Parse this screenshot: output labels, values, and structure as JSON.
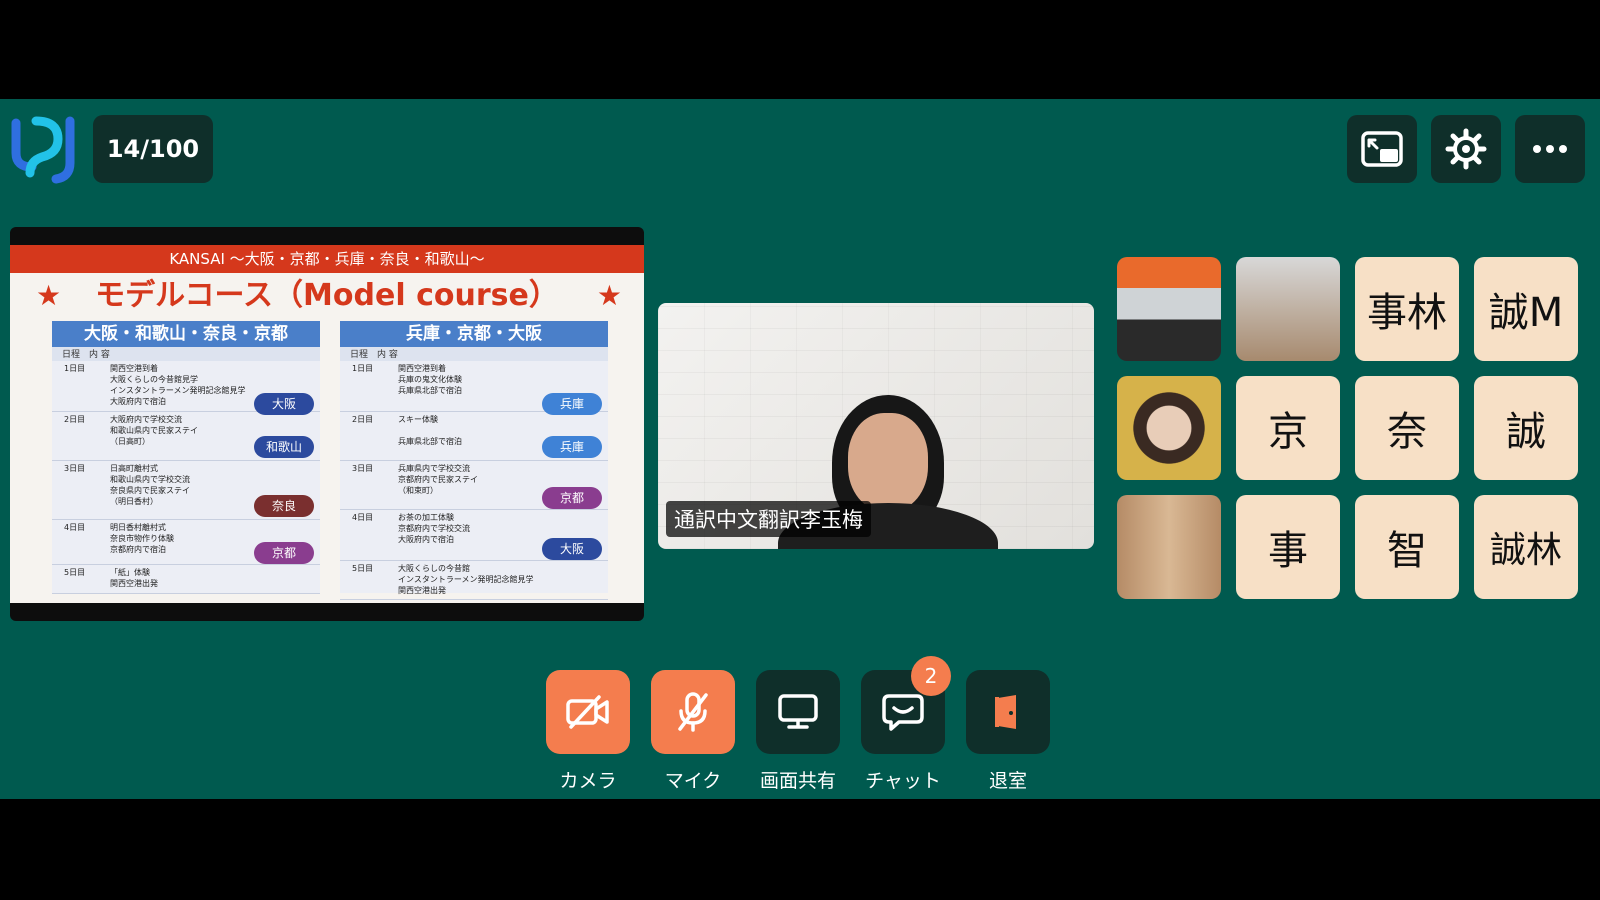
{
  "header": {
    "slide_counter": "14/100"
  },
  "colors": {
    "app_bg": "#005a4f",
    "accent": "#f47d4e",
    "button_dark": "#0f2f2a",
    "name_tile": "#f7e0c6"
  },
  "slide": {
    "banner": "KANSAI 〜大阪・京都・兵庫・奈良・和歌山〜",
    "title": "モデルコース（Model course）",
    "star": "★",
    "left_col": {
      "heading": "大阪・和歌山・奈良・京都",
      "sub": "日程　内 容",
      "rows": [
        {
          "day": "1日目",
          "lines": [
            "関西空港到着",
            "大阪くらしの今昔館見学",
            "インスタントラーメン発明記念館見学",
            "大阪府内で宿泊"
          ]
        },
        {
          "day": "2日目",
          "lines": [
            "大阪府内で学校交流",
            "和歌山県内で民家ステイ",
            "（日高町）"
          ]
        },
        {
          "day": "3日目",
          "lines": [
            "日高町離村式",
            "和歌山県内で学校交流",
            "奈良県内で民家ステイ",
            "（明日香村）"
          ]
        },
        {
          "day": "4日目",
          "lines": [
            "明日香村離村式",
            "奈良市物作り体験",
            "京都府内で宿泊"
          ]
        },
        {
          "day": "5日目",
          "lines": [
            "「紙」体験",
            "関西空港出発"
          ]
        }
      ],
      "pills": [
        "大阪",
        "和歌山",
        "奈良",
        "京都"
      ]
    },
    "right_col": {
      "heading": "兵庫・京都・大阪",
      "sub": "日程　内 容",
      "rows": [
        {
          "day": "1日目",
          "lines": [
            "関西空港到着",
            "兵庫の鬼文化体験",
            "兵庫県北部で宿泊"
          ]
        },
        {
          "day": "2日目",
          "lines": [
            "スキー体験",
            "兵庫県北部で宿泊"
          ]
        },
        {
          "day": "3日目",
          "lines": [
            "兵庫県内で学校交流",
            "京都府内で民家ステイ",
            "（和束町）"
          ]
        },
        {
          "day": "4日目",
          "lines": [
            "お茶の加工体験",
            "京都府内で学校交流",
            "大阪府内で宿泊"
          ]
        },
        {
          "day": "5日目",
          "lines": [
            "大阪くらしの今昔館",
            "インスタントラーメン発明記念館見学",
            "関西空港出発"
          ]
        }
      ],
      "pills": [
        "兵庫",
        "兵庫",
        "京都",
        "大阪"
      ]
    }
  },
  "main_video": {
    "name": "通訳中文翻訳李玉梅"
  },
  "participants": [
    {
      "type": "cam",
      "icon": "conference-room-photo"
    },
    {
      "type": "cam",
      "icon": "masked-woman-photo"
    },
    {
      "type": "text",
      "label": "事林"
    },
    {
      "type": "text",
      "label": "誠M"
    },
    {
      "type": "cam",
      "icon": "masked-woman-yellow-photo"
    },
    {
      "type": "text",
      "label": "京"
    },
    {
      "type": "text",
      "label": "奈"
    },
    {
      "type": "text",
      "label": "誠"
    },
    {
      "type": "cam",
      "icon": "woman-headset-photo"
    },
    {
      "type": "text",
      "label": "事"
    },
    {
      "type": "text",
      "label": "智"
    },
    {
      "type": "text",
      "label": "誠林"
    }
  ],
  "controls": {
    "camera": "カメラ",
    "mic": "マイク",
    "share": "画面共有",
    "chat": "チャット",
    "chat_badge": "2",
    "leave": "退室"
  }
}
